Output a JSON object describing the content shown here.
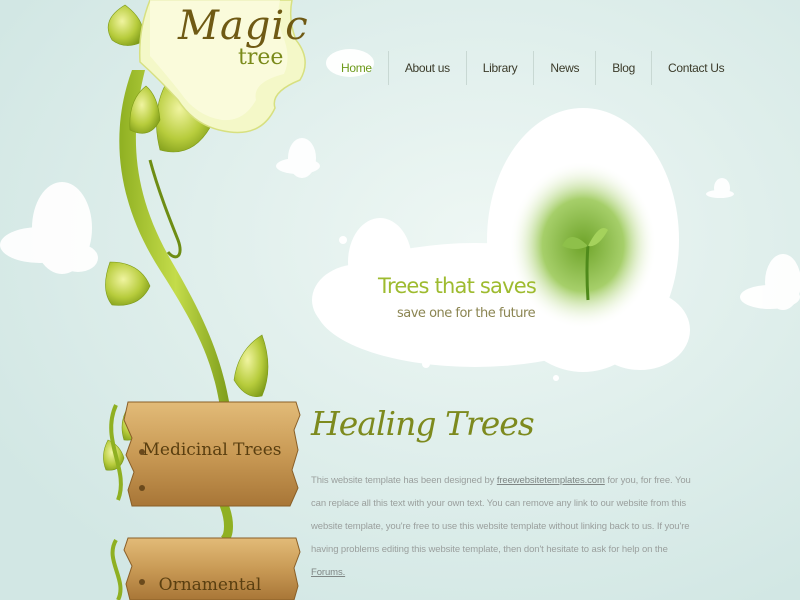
{
  "logo": {
    "main": "Magic",
    "sub": "tree"
  },
  "nav": {
    "items": [
      {
        "label": "Home",
        "active": true
      },
      {
        "label": "About us"
      },
      {
        "label": "Library"
      },
      {
        "label": "News"
      },
      {
        "label": "Blog"
      },
      {
        "label": "Contact Us"
      }
    ]
  },
  "hero": {
    "title": "Trees that saves",
    "subtitle": "save one for the future"
  },
  "sidebar": {
    "signs": [
      "Medicinal Trees",
      "Ornamental"
    ]
  },
  "content": {
    "title": "Healing Trees",
    "p1": "This website template has been designed by ",
    "link1": "freewebsitetemplates.com",
    "p2": " for you, for free. You can replace all this text with your own text. You can remove any link to our website from this website template, you're free to use this website template without linking back to us. If you're having problems editing this website template, then don't hesitate to ask for help on the ",
    "link2": "Forums.",
    "p3": ""
  },
  "colors": {
    "background": "#d9ecea",
    "accent": "#9ebb2f",
    "title": "#7d8a1e",
    "wood": "#c99a55"
  }
}
